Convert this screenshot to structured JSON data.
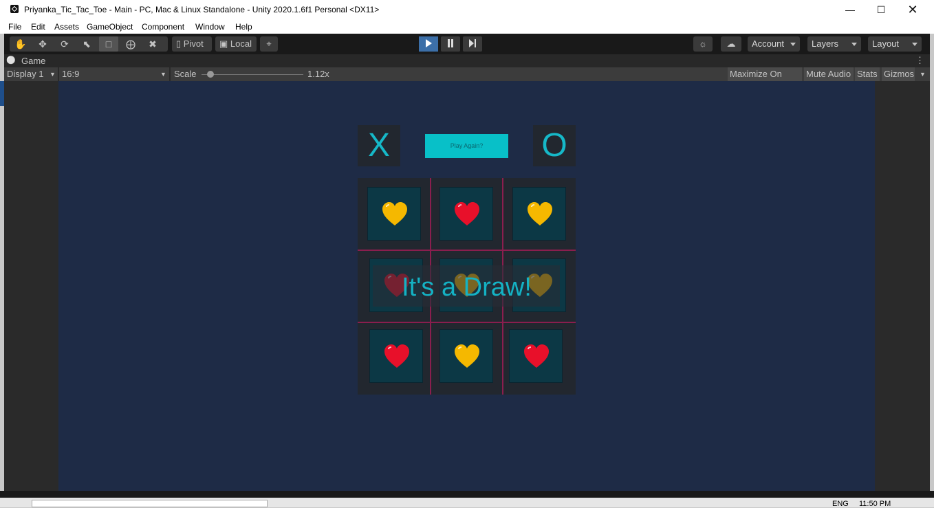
{
  "window": {
    "title": "Priyanka_Tic_Tac_Toe - Main - PC, Mac & Linux Standalone - Unity 2020.1.6f1 Personal <DX11>",
    "controls": [
      "minimize-icon",
      "maximize-icon",
      "close-icon"
    ]
  },
  "menu": {
    "items": [
      "File",
      "Edit",
      "Assets",
      "GameObject",
      "Component",
      "Window",
      "Help"
    ]
  },
  "toolbar": {
    "tools": [
      "hand-tool-icon",
      "move-tool-icon",
      "rotate-tool-icon",
      "scale-tool-icon",
      "rect-tool-icon",
      "transform-tool-icon",
      "custom-tool-icon"
    ],
    "pivot_label": "Pivot",
    "local_label": "Local",
    "account_label": "Account",
    "layers_label": "Layers",
    "layout_label": "Layout"
  },
  "game_tab": {
    "tab_label": "Game",
    "display": "Display 1",
    "aspect": "16:9",
    "scale_label": "Scale",
    "scale_value": "1.12x",
    "maximize_on_play": "Maximize On Play",
    "mute_audio": "Mute Audio",
    "stats": "Stats",
    "gizmos": "Gizmos"
  },
  "game": {
    "player_x": "X",
    "player_o": "O",
    "play_again": "Play Again?",
    "result": "It's a Draw!",
    "board": [
      [
        "yellow-heart",
        "red-heart",
        "yellow-heart"
      ],
      [
        "red-heart",
        "yellow-heart",
        "yellow-heart"
      ],
      [
        "red-heart",
        "yellow-heart",
        "red-heart"
      ]
    ],
    "colors": {
      "background": "#1e2b46",
      "accent": "#16b8c8",
      "red_heart": "#e8102a",
      "yellow_heart": "#f5b800",
      "grid": "#8a1e4e"
    }
  },
  "tray": {
    "lang": "ENG",
    "time": "11:50 PM"
  }
}
